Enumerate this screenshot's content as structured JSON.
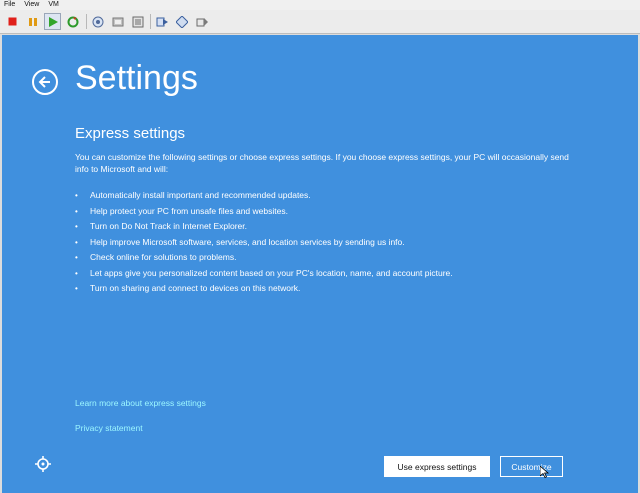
{
  "host": {
    "menu": [
      "File",
      "View",
      "VM"
    ],
    "toolbar_icons": [
      "power-off-icon",
      "pause-icon",
      "play-icon",
      "reset-icon",
      "snapshot-icon",
      "revert-snapshot-icon",
      "snapshot-manager-icon",
      "send-ctrl-alt-del-icon",
      "fullscreen-icon",
      "unity-icon"
    ]
  },
  "colors": {
    "background": "#4090de",
    "link": "#9cf6ff"
  },
  "page": {
    "title": "Settings",
    "subtitle": "Express settings",
    "description": "You can customize the following settings or choose express settings. If you choose express settings, your PC will occasionally send info to Microsoft and will:",
    "bullets": [
      "Automatically install important and recommended updates.",
      "Help protect your PC from unsafe files and websites.",
      "Turn on Do Not Track in Internet Explorer.",
      "Help improve Microsoft software, services, and location services by sending us info.",
      "Check online for solutions to problems.",
      "Let apps give you personalized content based on your PC's location, name, and account picture.",
      "Turn on sharing and connect to devices on this network."
    ],
    "learn_more_link": "Learn more about express settings",
    "privacy_link": "Privacy statement",
    "use_express_button": "Use express settings",
    "customize_button": "Customize"
  }
}
